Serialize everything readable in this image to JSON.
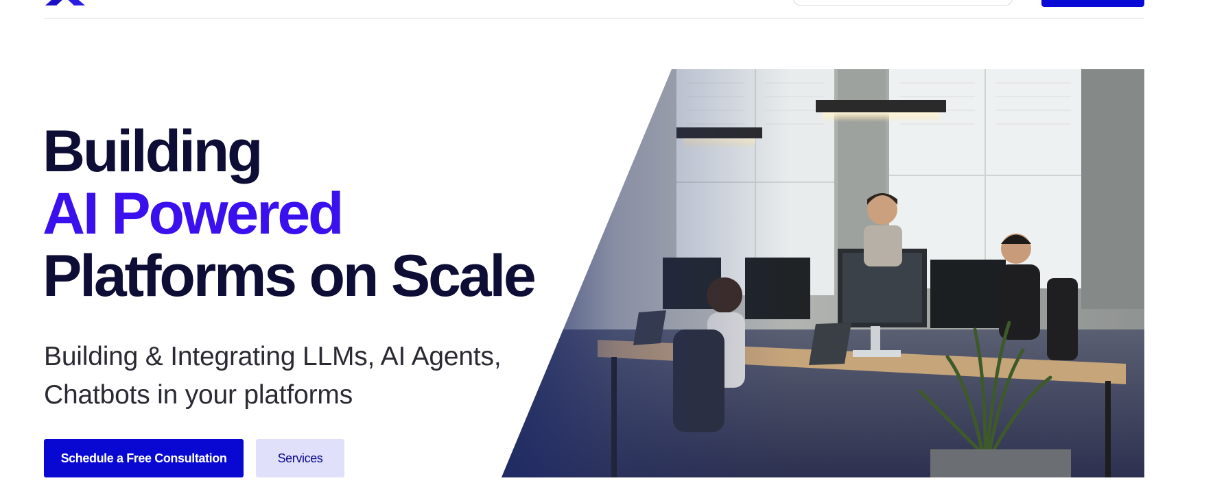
{
  "hero": {
    "headline_line1": "Building",
    "headline_line2": "AI Powered",
    "headline_line3": "Platforms on Scale",
    "subhead_line1": "Building & Integrating LLMs, AI Agents,",
    "subhead_line2": "Chatbots in your platforms",
    "primary_button": "Schedule a Free Consultation",
    "secondary_button": "Services"
  },
  "colors": {
    "brand_blue": "#0808d2",
    "accent_purple": "#3b10ef",
    "headline_dark": "#0d0d35",
    "secondary_bg": "#e0e0fb"
  },
  "icons": {
    "logo": "brand-logo-icon"
  }
}
